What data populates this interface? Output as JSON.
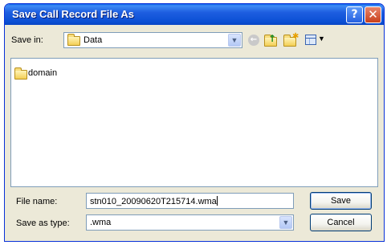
{
  "window": {
    "title": "Save Call Record File As",
    "help_symbol": "?",
    "close_symbol": "✕"
  },
  "toolbar": {
    "save_in_label": "Save in:",
    "save_in_value": "Data",
    "icons": [
      "folder-icon",
      "back-icon",
      "up-folder-icon",
      "new-folder-icon",
      "views-menu-icon"
    ]
  },
  "file_list": {
    "items": [
      {
        "icon": "folder-icon",
        "label": "domain"
      }
    ]
  },
  "footer": {
    "file_name_label": "File name:",
    "file_name_value": "stn010_20090620T215714.wma",
    "save_as_type_label": "Save as type:",
    "save_as_type_value": ".wma",
    "save_button": "Save",
    "cancel_button": "Cancel"
  },
  "colors": {
    "title_bar": "#0b4fd4",
    "dialog_bg": "#ece9d8",
    "field_border": "#7f9db9",
    "button_border": "#003c74"
  }
}
